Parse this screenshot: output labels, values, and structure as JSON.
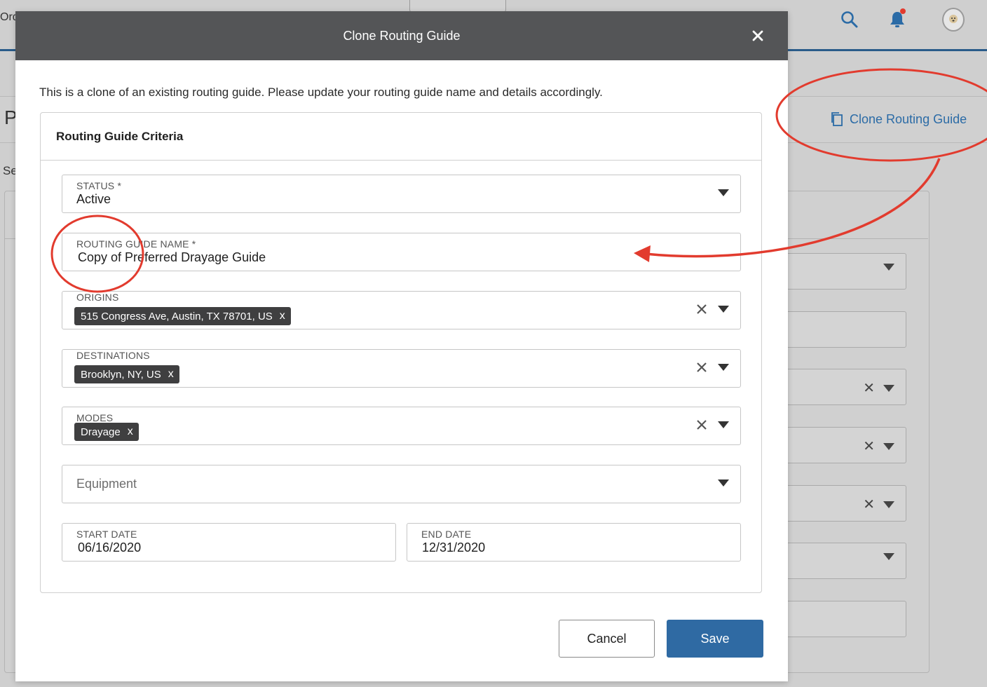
{
  "background": {
    "partial_nav_text": "Ord",
    "partial_page_title": "P",
    "partial_section_text": "Se",
    "clone_link_label": "Clone Routing Guide",
    "accent_color": "#2b6ba6",
    "icons": [
      "search-icon",
      "bell-icon",
      "avatar-icon",
      "copy-icon"
    ]
  },
  "modal": {
    "title": "Clone Routing Guide",
    "intro": "This is a clone of an existing routing guide. Please update your routing guide name and details accordingly.",
    "section_title": "Routing Guide Criteria",
    "fields": {
      "status": {
        "label": "STATUS *",
        "value": "Active"
      },
      "routing_guide_name": {
        "label": "ROUTING GUIDE NAME *",
        "value": "Copy of Preferred Drayage Guide"
      },
      "origins": {
        "label": "ORIGINS",
        "chips": [
          "515 Congress Ave, Austin, TX 78701, US"
        ]
      },
      "destinations": {
        "label": "DESTINATIONS",
        "chips": [
          "Brooklyn, NY, US"
        ]
      },
      "modes": {
        "label": "MODES",
        "chips": [
          "Drayage"
        ]
      },
      "equipment": {
        "placeholder": "Equipment"
      },
      "start_date": {
        "label": "START DATE",
        "value": "06/16/2020"
      },
      "end_date": {
        "label": "END DATE",
        "value": "12/31/2020"
      }
    },
    "chip_remove_glyph": "x",
    "buttons": {
      "cancel": "Cancel",
      "save": "Save"
    },
    "primary_color": "#2f6aa3",
    "header_color": "#545557"
  },
  "annotation_color": "#e23b2e"
}
